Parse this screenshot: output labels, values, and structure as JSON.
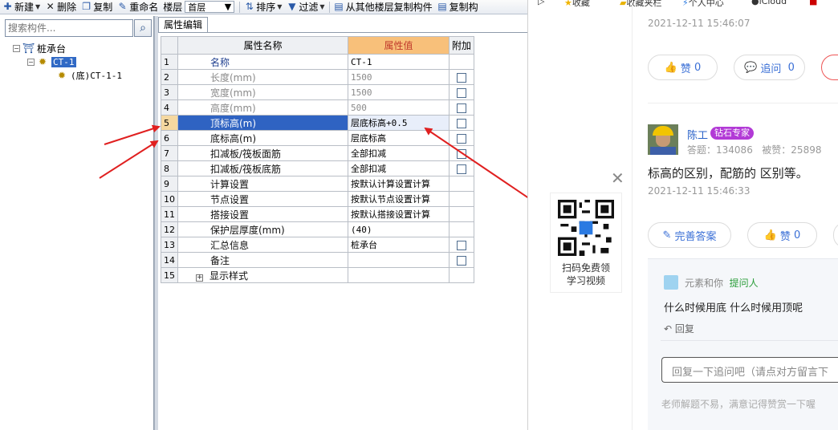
{
  "toolbar": {
    "new": "新建",
    "delete": "删除",
    "copy": "复制",
    "rename": "重命名",
    "floor_label": "楼层",
    "floor_value": "首层",
    "sort": "排序",
    "filter": "过滤",
    "copy_from_floor": "从其他楼层复制构件",
    "copy_to": "复制构"
  },
  "left": {
    "search_placeholder": "搜索构件...",
    "tree": {
      "root": "桩承台",
      "child": "CT-1",
      "leaf_prefix": "(底)",
      "leaf_name": "CT-1-1"
    }
  },
  "prop_tab": "属性编辑",
  "grid": {
    "headers": {
      "name": "属性名称",
      "value": "属性值",
      "extra": "附加"
    },
    "rows": [
      {
        "num": "1",
        "name": "名称",
        "value": "CT-1",
        "checkbox": false
      },
      {
        "num": "2",
        "name": "长度(mm)",
        "value": "1500",
        "checkbox": true
      },
      {
        "num": "3",
        "name": "宽度(mm)",
        "value": "1500",
        "checkbox": true
      },
      {
        "num": "4",
        "name": "高度(mm)",
        "value": "500",
        "checkbox": true
      },
      {
        "num": "5",
        "name": "顶标高(m)",
        "value": "层底标高+0.5",
        "checkbox": true
      },
      {
        "num": "6",
        "name": "底标高(m)",
        "value": "层底标高",
        "checkbox": true
      },
      {
        "num": "7",
        "name": "扣减板/筏板面筋",
        "value": "全部扣减",
        "checkbox": true
      },
      {
        "num": "8",
        "name": "扣减板/筏板底筋",
        "value": "全部扣减",
        "checkbox": true
      },
      {
        "num": "9",
        "name": "计算设置",
        "value": "按默认计算设置计算",
        "checkbox": false
      },
      {
        "num": "10",
        "name": "节点设置",
        "value": "按默认节点设置计算",
        "checkbox": false
      },
      {
        "num": "11",
        "name": "搭接设置",
        "value": "按默认搭接设置计算",
        "checkbox": false
      },
      {
        "num": "12",
        "name": "保护层厚度(mm)",
        "value": "(40)",
        "checkbox": false
      },
      {
        "num": "13",
        "name": "汇总信息",
        "value": "桩承台",
        "checkbox": true
      },
      {
        "num": "14",
        "name": "备注",
        "value": "",
        "checkbox": true
      },
      {
        "num": "15",
        "name": "显示样式",
        "value": "",
        "checkbox": false
      }
    ]
  },
  "browser": {
    "bookmarks": [
      "收藏",
      "收藏夹栏",
      "个人中心",
      "iCloud"
    ],
    "answer1": {
      "time": "2021-12-11 15:46:07",
      "like_label": "赞",
      "like_count": "0",
      "followup_label": "追问",
      "followup_count": "0"
    },
    "answer2": {
      "author": "陈工",
      "badge": "钻石专家",
      "answers_label": "答题：",
      "answers_count": "134086",
      "liked_label": "被赞：",
      "liked_count": "25898",
      "text": "标高的区别，配筋的 区别等。",
      "time": "2021-12-11 15:46:33",
      "improve_label": "完善答案",
      "like_label": "赞",
      "like_count": "0"
    },
    "qr": {
      "line1": "扫码免费领",
      "line2": "学习视频"
    },
    "followup": {
      "user": "元素和你",
      "role": "提问人",
      "text": "什么时候用底 什么时候用顶呢",
      "reply_label": "回复",
      "input_placeholder": "回复一下追问吧（请点对方留言下",
      "footer": "老师解题不易，满意记得赞赏一下喔"
    }
  },
  "colors": {
    "selection_blue": "#2f63c2",
    "header_orange": "#f8c07a",
    "link_blue": "#3a6fd6",
    "badge_purple": "#b23ad6",
    "arrow_red": "#e02020"
  }
}
